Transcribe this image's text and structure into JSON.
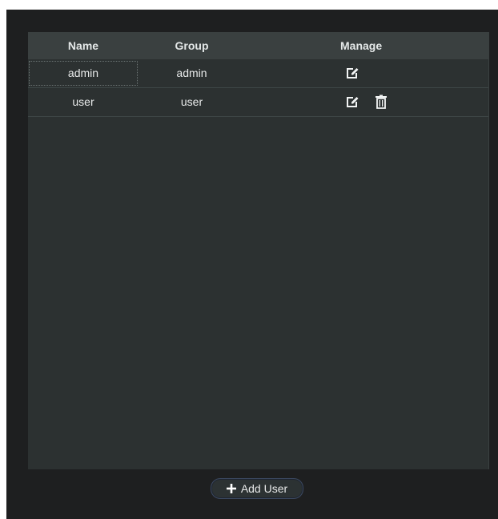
{
  "table": {
    "columns": [
      "Name",
      "Group",
      "Manage"
    ],
    "rows": [
      {
        "name": "admin",
        "group": "admin",
        "actions": [
          "edit-icon"
        ]
      },
      {
        "name": "user",
        "group": "user",
        "actions": [
          "edit-icon",
          "delete-icon"
        ]
      }
    ]
  },
  "actions": {
    "add_user_label": "Add User",
    "add_icon": "plus-icon"
  },
  "colors": {
    "background": "#1e1f20",
    "table_bg": "#2c3131",
    "header_bg": "#3a4040",
    "text": "#e8eaea"
  }
}
